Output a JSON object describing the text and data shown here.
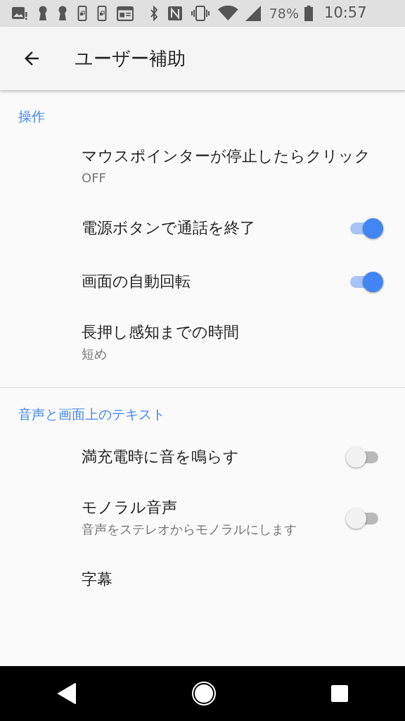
{
  "status_bar": {
    "battery": "78%",
    "time": "10:57"
  },
  "app_bar": {
    "title": "ユーザー補助"
  },
  "sections": [
    {
      "header": "操作",
      "items": [
        {
          "kind": "text",
          "title": "マウスポインターが停止したらクリック",
          "summary": "OFF"
        },
        {
          "kind": "switch",
          "title": "電源ボタンで通話を終了",
          "on": true
        },
        {
          "kind": "switch",
          "title": "画面の自動回転",
          "on": true
        },
        {
          "kind": "text",
          "title": "長押し感知までの時間",
          "summary": "短め"
        }
      ]
    },
    {
      "header": "音声と画面上のテキスト",
      "items": [
        {
          "kind": "switch",
          "title": "満充電時に音を鳴らす",
          "on": false
        },
        {
          "kind": "switch",
          "title": "モノラル音声",
          "summary": "音声をステレオからモノラルにします",
          "on": false
        },
        {
          "kind": "text",
          "title": "字幕"
        }
      ]
    }
  ]
}
